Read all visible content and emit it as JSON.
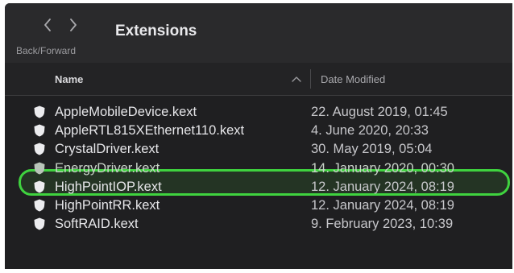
{
  "toolbar": {
    "title": "Extensions",
    "nav_caption": "Back/Forward",
    "back_icon": "chevron-left-icon",
    "forward_icon": "chevron-right-icon"
  },
  "columns": {
    "name": "Name",
    "date_modified": "Date Modified",
    "sort_icon": "chevron-up-icon"
  },
  "files": [
    {
      "name": "AppleMobileDevice.kext",
      "date": "22. August 2019, 01:45",
      "icon": "kext-shield-icon"
    },
    {
      "name": "AppleRTL815XEthernet110.kext",
      "date": "4. June 2020, 20:33",
      "icon": "kext-shield-icon"
    },
    {
      "name": "CrystalDriver.kext",
      "date": "30. May 2019, 05:04",
      "icon": "kext-shield-icon"
    },
    {
      "name": "EnergyDriver.kext",
      "date": "14. January 2020, 00:30",
      "icon": "kext-shield-icon",
      "highlighted": true
    },
    {
      "name": "HighPointIOP.kext",
      "date": "12. January 2024, 08:19",
      "icon": "kext-shield-icon"
    },
    {
      "name": "HighPointRR.kext",
      "date": "12. January 2024, 08:19",
      "icon": "kext-shield-icon"
    },
    {
      "name": "SoftRAID.kext",
      "date": "9. February 2023, 10:39",
      "icon": "kext-shield-icon"
    }
  ],
  "colors": {
    "highlight_border": "#3fd33f",
    "background": "#1f1f21"
  }
}
